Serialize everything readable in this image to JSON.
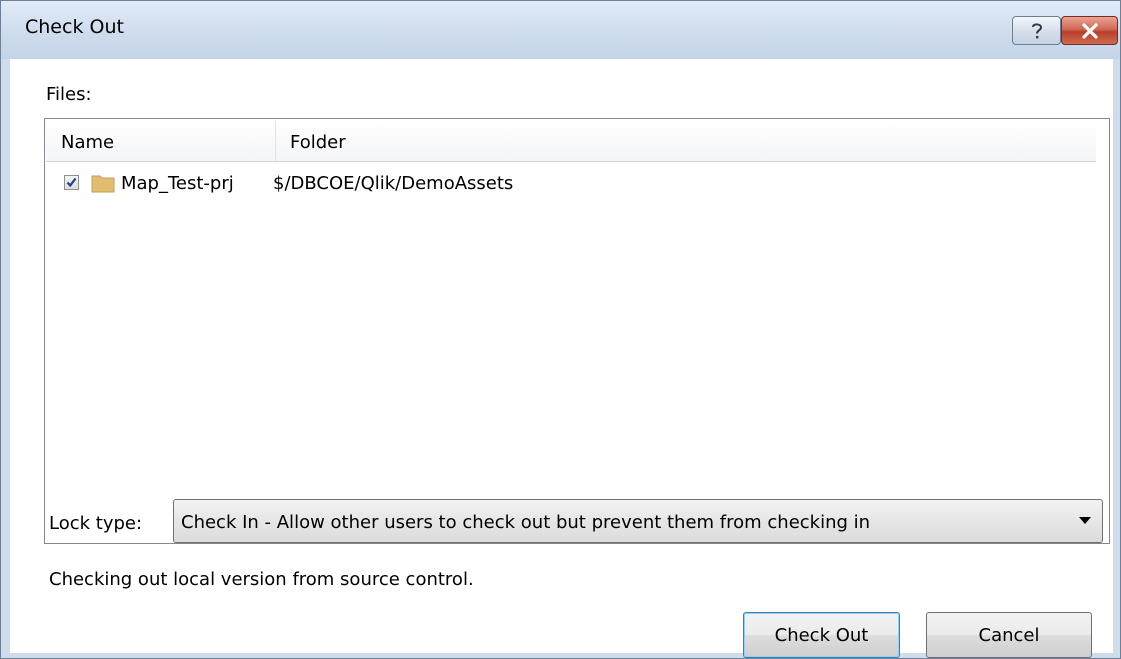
{
  "dialog": {
    "title": "Check Out",
    "help_glyph": "?",
    "close_glyph": "×"
  },
  "files": {
    "label": "Files:",
    "columns": {
      "name": "Name",
      "folder": "Folder"
    },
    "rows": [
      {
        "checked": true,
        "name": "Map_Test-prj",
        "folder": "$/DBCOE/Qlik/DemoAssets"
      }
    ]
  },
  "lock": {
    "label": "Lock type:",
    "selected": "Check In - Allow other users to check out but prevent them from checking in"
  },
  "status": "Checking out local version from source control.",
  "buttons": {
    "check_out": "Check Out",
    "cancel": "Cancel"
  },
  "colors": {
    "titlebar": "#cfddee",
    "folder": "#e0bd72",
    "checkmark": "#1f3f8f",
    "close_button": "#c9543e"
  }
}
